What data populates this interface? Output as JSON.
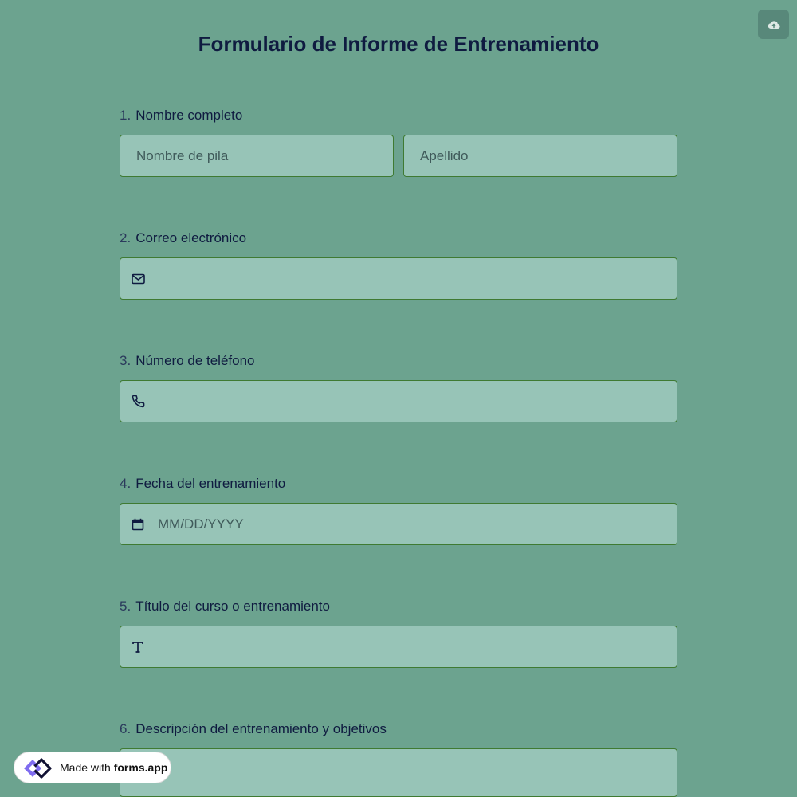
{
  "header": {
    "title": "Formulario de Informe de Entrenamiento",
    "save_icon": "cloud-upload-icon"
  },
  "questions": [
    {
      "number": "1.",
      "label": "Nombre completo",
      "first_name_placeholder": "Nombre de pila",
      "last_name_placeholder": "Apellido"
    },
    {
      "number": "2.",
      "label": "Correo electrónico",
      "icon": "mail-icon"
    },
    {
      "number": "3.",
      "label": "Número de teléfono",
      "icon": "phone-icon"
    },
    {
      "number": "4.",
      "label": "Fecha del entrenamiento",
      "icon": "calendar-icon",
      "placeholder": "MM/DD/YYYY"
    },
    {
      "number": "5.",
      "label": "Título del curso o entrenamiento",
      "icon": "text-icon"
    },
    {
      "number": "6.",
      "label": "Descripción del entrenamiento y objetivos"
    }
  ],
  "badge": {
    "made_with": "Made with",
    "brand": "forms.app",
    "logo_icon": "forms-app-logo-icon"
  },
  "colors": {
    "background": "#6ca38f",
    "field_background": "#97c4b7",
    "field_border": "#3f7a32",
    "title": "#0f1b40"
  }
}
